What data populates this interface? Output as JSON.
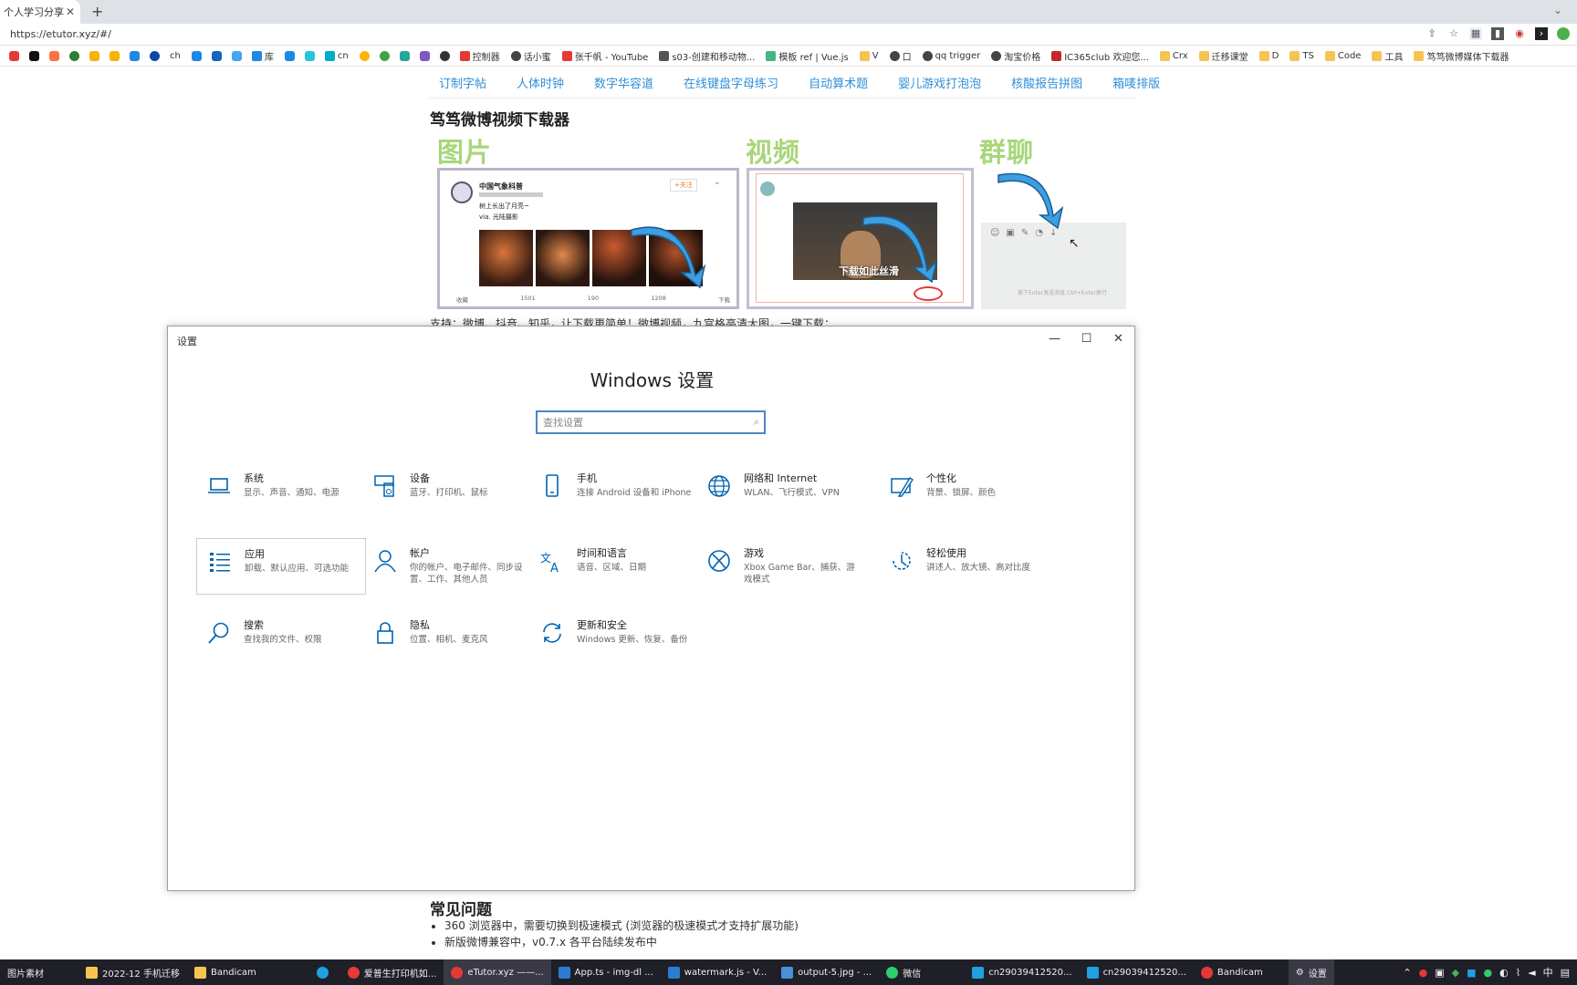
{
  "browser": {
    "tab_title": "个人学习分享",
    "url": "https://etutor.xyz/#/",
    "bookmarks": [
      "ch",
      "库",
      "cn",
      "控制器",
      "话小蜜",
      "张千帆 - YouTube",
      "s03-创建和移动物...",
      "模板 ref | Vue.js",
      "V",
      "口",
      "qq trigger",
      "淘宝价格",
      "IC365club 欢迎您...",
      "Crx",
      "迁移课堂",
      "D",
      "TS",
      "Code",
      "工具",
      "笃笃微博媒体下载器"
    ]
  },
  "page": {
    "nav": [
      "订制字帖",
      "人体时钟",
      "数字华容道",
      "在线键盘字母练习",
      "自动算术题",
      "婴儿游戏打泡泡",
      "核酸报告拼图",
      "箱唛排版"
    ],
    "app_title": "笃笃微博视频下载器",
    "section_labels": [
      "图片",
      "视频",
      "群聊"
    ],
    "features_text": "支持：微博、抖音、知乎，让下载更简单！微博视频，九宫格高清大图，一键下载；",
    "faq_title": "常见问题",
    "faq_items": [
      "360 浏览器中，需要切换到极速模式 (浏览器的极速模式才支持扩展功能)",
      "新版微博兼容中，v0.7.x 各平台陆续发布中"
    ],
    "card_weibo": {
      "user": "中国气象科普",
      "follow": "+关注",
      "post": "树上长出了月亮~",
      "tags": "via. 光陆摄影",
      "stats": [
        "收藏",
        "1501",
        "190",
        "1208",
        "下载"
      ]
    },
    "card_video": {
      "caption": "下载如此丝滑"
    },
    "card_chat": {
      "hint": "按下Enter发送消息 Ctrl+Enter换行"
    }
  },
  "settings": {
    "window_title": "设置",
    "heading": "Windows 设置",
    "search_placeholder": "查找设置",
    "categories": [
      {
        "name": "系统",
        "desc": "显示、声音、通知、电源",
        "icon": "laptop-icon"
      },
      {
        "name": "设备",
        "desc": "蓝牙、打印机、鼠标",
        "icon": "devices-icon"
      },
      {
        "name": "手机",
        "desc": "连接 Android 设备和 iPhone",
        "icon": "phone-icon"
      },
      {
        "name": "网络和 Internet",
        "desc": "WLAN、飞行模式、VPN",
        "icon": "globe-icon"
      },
      {
        "name": "个性化",
        "desc": "背景、锁屏、颜色",
        "icon": "brush-icon"
      },
      {
        "name": "应用",
        "desc": "卸载、默认应用、可选功能",
        "icon": "apps-list-icon"
      },
      {
        "name": "帐户",
        "desc": "你的帐户、电子邮件、同步设置、工作、其他人员",
        "icon": "person-icon"
      },
      {
        "name": "时间和语言",
        "desc": "语音、区域、日期",
        "icon": "time-language-icon"
      },
      {
        "name": "游戏",
        "desc": "Xbox Game Bar、捕获、游戏模式",
        "icon": "xbox-icon"
      },
      {
        "name": "轻松使用",
        "desc": "讲述人、放大镜、高对比度",
        "icon": "ease-of-access-icon"
      },
      {
        "name": "搜索",
        "desc": "查找我的文件、权限",
        "icon": "search-icon"
      },
      {
        "name": "隐私",
        "desc": "位置、相机、麦克风",
        "icon": "lock-icon"
      },
      {
        "name": "更新和安全",
        "desc": "Windows 更新、恢复、备份",
        "icon": "update-icon"
      }
    ]
  },
  "taskbar": {
    "items": [
      "图片素材",
      "2022-12 手机迁移",
      "Bandicam",
      "",
      "爱普生打印机如...",
      "eTutor.xyz ——...",
      "App.ts - img-dl ...",
      "watermark.js - V...",
      "output-5.jpg - ...",
      "微信",
      "cn29039412520...",
      "cn29039412520...",
      "Bandicam",
      "设置"
    ],
    "ime": "中"
  },
  "colors": {
    "accent": "#0063b1",
    "nav_link": "#2f8fd8",
    "section_green": "#a8d67a",
    "taskbar": "#1f1f28"
  }
}
